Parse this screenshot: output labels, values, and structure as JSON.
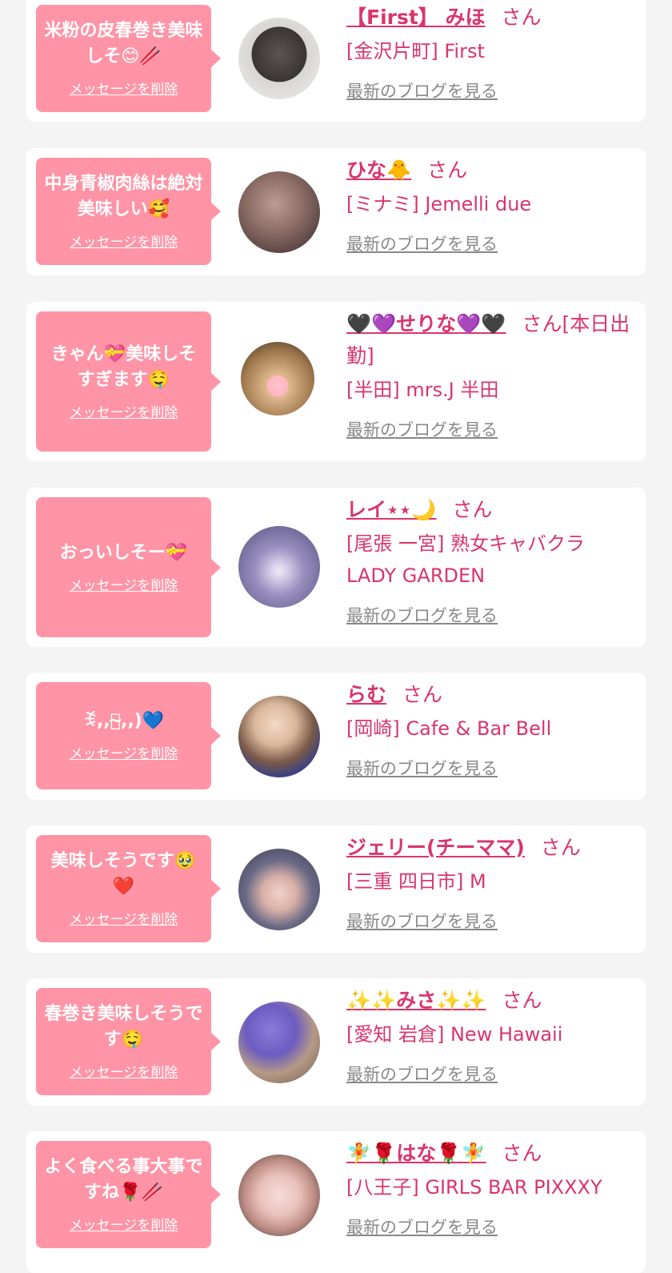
{
  "delete_label": "メッセージを削除",
  "blog_label": "最新のブログを見る",
  "san_label": "さん",
  "colors": {
    "bubble": "#ff94a6",
    "accent": "#d9356b",
    "link_gray": "#888888",
    "background": "#f4f4f4"
  },
  "items": [
    {
      "message": "米粉の皮春巻き美味しそ😊🥢",
      "name": "【First】 みほ",
      "suffix": "さん",
      "shop": "[金沢片町] First"
    },
    {
      "message": "中身青椒肉絲は絶対美味しい🥰",
      "name": "ひな🐥",
      "suffix": "さん",
      "shop": "[ミナミ] Jemelli due"
    },
    {
      "message": "きゃん💝美味しそすぎます🤤",
      "name": "🖤💜せりな💜🖤",
      "suffix": "さん[本日出勤]",
      "shop": "[半田] mrs.J 半田"
    },
    {
      "message": "おっいしそー💝",
      "name": "レイ⋆⋆🌙",
      "suffix": "さん",
      "shop": "[尾張 一宮] 熟女キャバクラ LADY GARDEN"
    },
    {
      "message": "ꉂ,,ꇐ̴,,)💙",
      "name": "らむ",
      "suffix": "さん",
      "shop": "[岡崎] Cafe & Bar Bell"
    },
    {
      "message": "美味しそうです🥹❤️",
      "name": "ジェリー(チーママ)",
      "suffix": "さん",
      "shop": "[三重 四日市] M"
    },
    {
      "message": "春巻き美味しそうです🤤",
      "name": "✨✨みさ✨✨",
      "suffix": "さん",
      "shop": "[愛知 岩倉] New Hawaii"
    },
    {
      "message": "よく食べる事大事ですね🌹🥢",
      "name": "🧚🌹はな🌹🧚",
      "suffix": "さん",
      "shop": "[八王子] GIRLS BAR PIXXXY"
    }
  ]
}
